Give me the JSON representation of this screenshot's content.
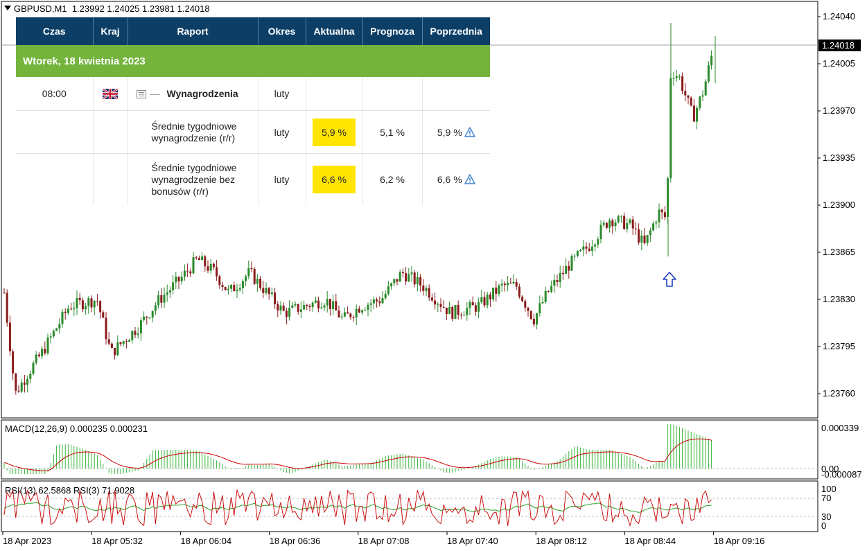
{
  "symbol": {
    "title": "GBPUSD,M1",
    "ohlc": "1.23992 1.24025 1.23981 1.24018"
  },
  "price_axis": {
    "labels": [
      "1.24040",
      "1.24005",
      "1.23970",
      "1.23935",
      "1.23900",
      "1.23865",
      "1.23830",
      "1.23795",
      "1.23760"
    ],
    "current_price": "1.24018"
  },
  "macd": {
    "label": "MACD(12,26,9) 0.000235 0.000231",
    "axis_labels": [
      "0.000339",
      "0.00",
      "-0.000087"
    ]
  },
  "rsi": {
    "label": "RSI(13) 62.5868  RSI(3) 71.9028",
    "axis_labels": [
      "100",
      "70",
      "30",
      "0"
    ]
  },
  "time_axis": {
    "labels": [
      "18 Apr 2023",
      "18 Apr 05:32",
      "18 Apr 06:04",
      "18 Apr 06:36",
      "18 Apr 07:08",
      "18 Apr 07:40",
      "18 Apr 08:12",
      "18 Apr 08:44",
      "18 Apr 09:16"
    ]
  },
  "calendar": {
    "headers": [
      "Czas",
      "Kraj",
      "Raport",
      "Okres",
      "Aktualna",
      "Prognoza",
      "Poprzednia"
    ],
    "date": "Wtorek, 18 kwietnia 2023",
    "event": {
      "time": "08:00",
      "country_flag": "uk-flag-icon",
      "name": "Wynagrodzenia",
      "period": "luty"
    },
    "rows": [
      {
        "label_line1": "Średnie tygodniowe",
        "label_line2": "wynagrodzenie (r/r)",
        "label_line3": "",
        "period": "luty",
        "actual": "5,9 %",
        "forecast": "5,1 %",
        "previous": "5,9 %"
      },
      {
        "label_line1": "Średnie tygodniowe",
        "label_line2": "wynagrodzenie bez",
        "label_line3": "bonusów (r/r)",
        "period": "luty",
        "actual": "6,6 %",
        "forecast": "6,2 %",
        "previous": "6,6 %"
      }
    ]
  },
  "colors": {
    "bull": "#2a8a2a",
    "bear": "#8b1a1a",
    "macd_hist": "#39b539",
    "macd_signal": "#cc0000",
    "rsi13": "#22a022",
    "rsi3": "#cc1111",
    "header_bg": "#0d3f66",
    "date_bg": "#74b43c",
    "highlight": "#ffe500",
    "arrow": "#1f3fbf"
  },
  "annotation": {
    "arrow": "arrow-up-icon"
  }
}
